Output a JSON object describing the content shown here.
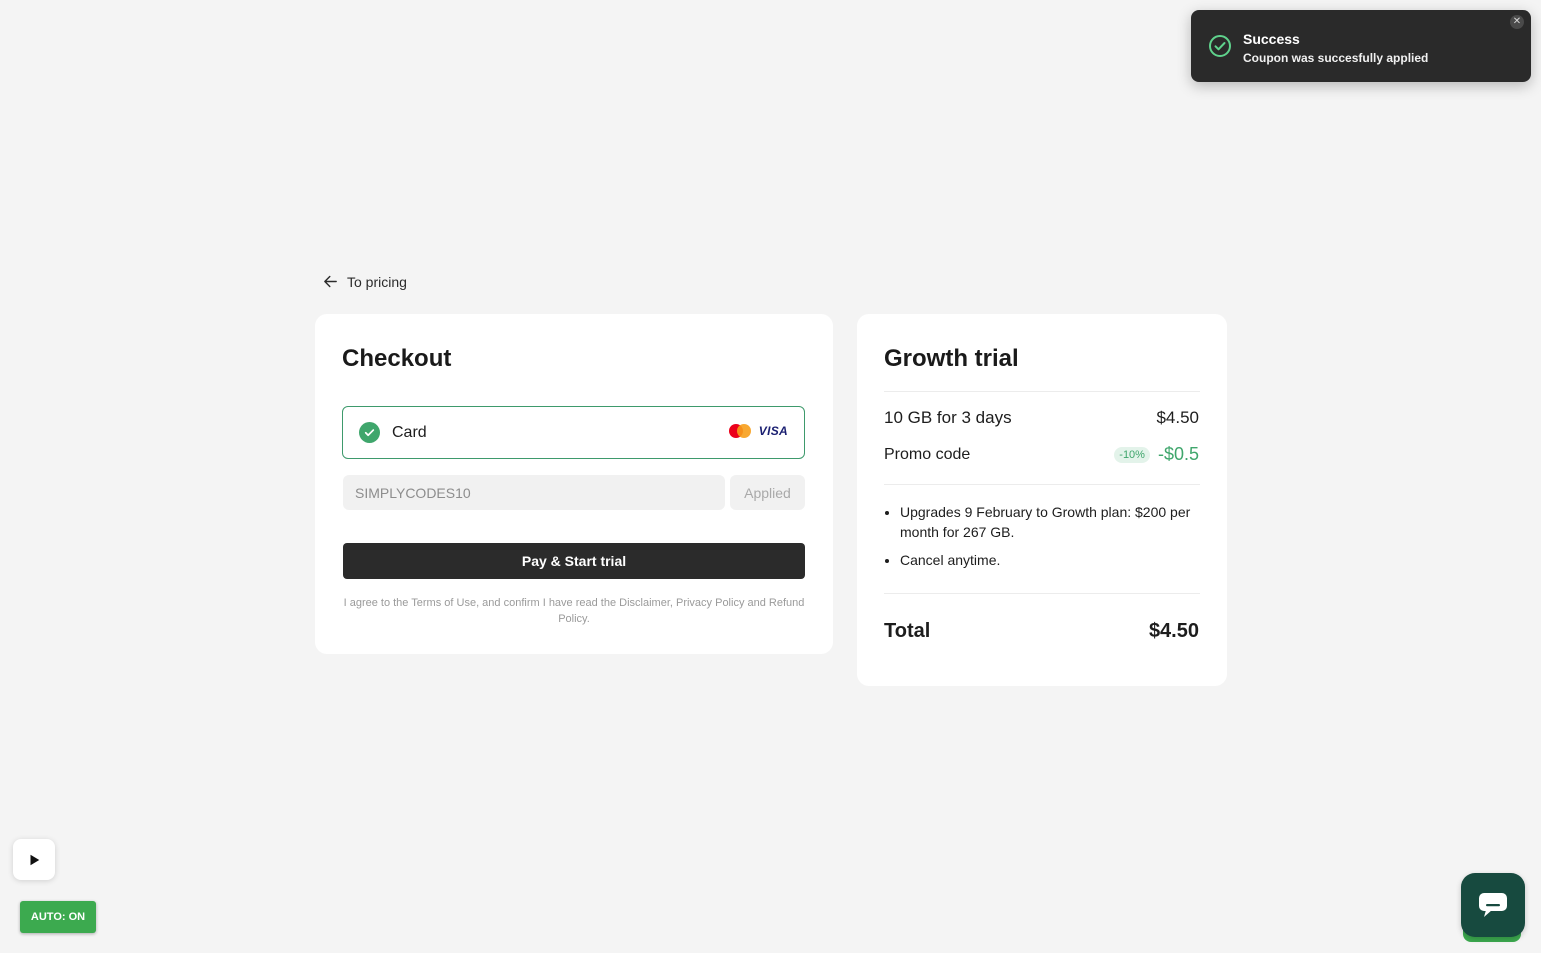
{
  "toast": {
    "title": "Success",
    "message": "Coupon was succesfully applied",
    "close": "✕"
  },
  "nav": {
    "back_label": "To pricing"
  },
  "checkout": {
    "title": "Checkout",
    "payment_method": "Card",
    "card_brand": "VISA",
    "promo_value": "SIMPLYCODES10",
    "promo_button": "Applied",
    "pay_button": "Pay & Start trial",
    "legal": "I agree to the Terms of Use, and confirm I have read the Disclaimer, Privacy Policy and Refund Policy."
  },
  "summary": {
    "title": "Growth trial",
    "plan_label": "10 GB for 3 days",
    "plan_price": "$4.50",
    "promo_label": "Promo code",
    "promo_badge": "-10%",
    "promo_discount": "-$0.5",
    "bullets": [
      "Upgrades 9 February to Growth plan: $200 per month for 267 GB.",
      "Cancel anytime."
    ],
    "total_label": "Total",
    "total_value": "$4.50"
  },
  "widgets": {
    "auto_label": "AUTO: ON"
  },
  "colors": {
    "accent_green": "#3fa66c",
    "dark": "#2b2b2b",
    "chat": "#174a3f"
  }
}
